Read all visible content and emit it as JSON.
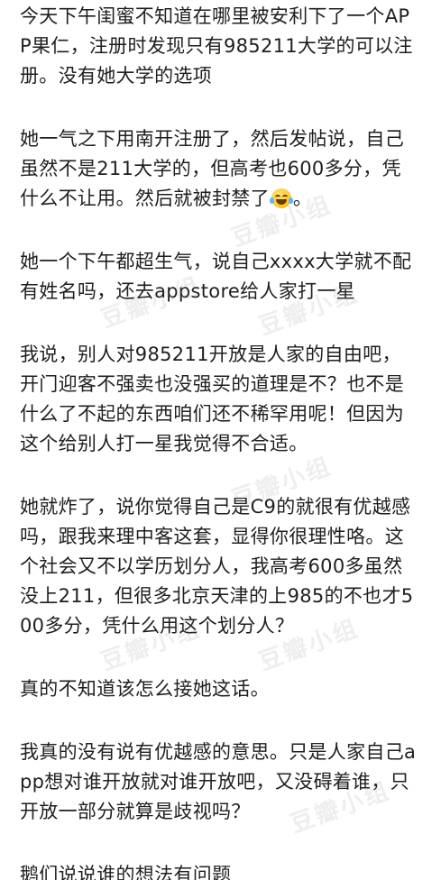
{
  "post": {
    "paragraphs": [
      "今天下午闺蜜不知道在哪里被安利下了一个APP果仁，注册时发现只有985211大学的可以注册。没有她大学的选项",
      "她一气之下用南开注册了，然后发帖说，自己虽然不是211大学的，但高考也600多分，凭什么不让用。然后就被封禁了",
      "她一个下午都超生气，说自己xxxx大学就不配有姓名吗，还去appstore给人家打一星",
      "我说，别人对985211开放是人家的自由吧，开门迎客不强卖也没强买的道理是不？也不是什么了不起的东西咱们还不稀罕用呢！但因为这个给别人打一星我觉得不合适。",
      "她就炸了，说你觉得自己是C9的就很有优越感吗，跟我来理中客这套，显得你很理性咯。这个社会又不以学历划分人，我高考600多虽然没上211，但很多北京天津的上985的不也才500多分，凭什么用这个划分人？",
      "真的不知道该怎么接她这话。",
      "我真的没有说有优越感的意思。只是人家自己app想对谁开放就对谁开放吧，又没碍着谁，只开放一部分就算是歧视吗？",
      "鹅们说说谁的想法有问题"
    ],
    "para2_suffix": "。",
    "emoji_icon": "tears-of-joy-emoji"
  },
  "watermark": {
    "text": "豆瓣小组"
  }
}
